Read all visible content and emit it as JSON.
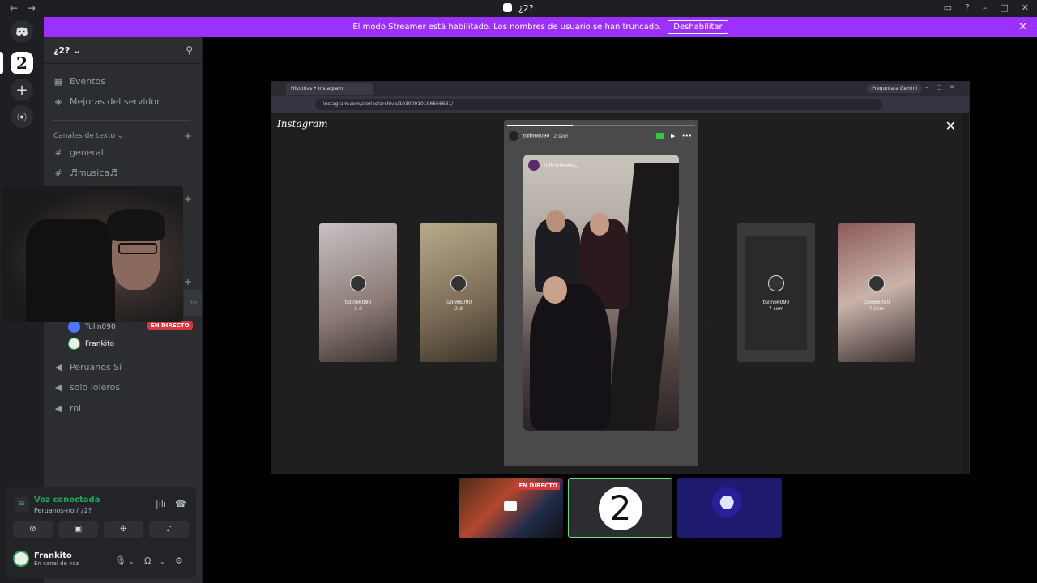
{
  "window": {
    "title": "¿2?",
    "nav_back": "←",
    "nav_fwd": "→",
    "controls": [
      "▭",
      "?",
      "–",
      "□",
      "✕"
    ]
  },
  "banner": {
    "text": "El modo Streamer está habilitado. Los nombres de usuario se han truncado.",
    "button": "Deshabilitar",
    "close": "✕"
  },
  "guilds": {
    "home_icon": "discord-icon",
    "server_label": "2",
    "add_icon": "+",
    "explore_icon": "⦿"
  },
  "server": {
    "name": "¿2? ⌄",
    "invite_icon": "⚲"
  },
  "sidebar": {
    "events": "Eventos",
    "boosts": "Mejoras del servidor",
    "text_category": "Canales de texto ⌄",
    "text_channels": [
      "general",
      "♬musica♬"
    ],
    "voice_count": "56",
    "voice_users": [
      {
        "name": "Tulin090",
        "badge": "EN DIRECTO"
      },
      {
        "name": "Frankito",
        "badge": ""
      }
    ],
    "voice_channels": [
      "Peruanos Sí",
      "solo loleros",
      "rol"
    ]
  },
  "voice_panel": {
    "status": "Voz conectada",
    "location": "Peruanos-no / ¿2?"
  },
  "user": {
    "name": "Frankito",
    "status": "En canal de voz"
  },
  "browser": {
    "tab_title": "Historias • Instagram",
    "url": "instagram.com/stories/archive/10300910196666631/",
    "gemini_label": "Pregunta a Gemini"
  },
  "instagram": {
    "logo": "Instagram",
    "close": "✕",
    "main_user": "tulin66090",
    "main_time": "2 sem",
    "inner_user": "milmvianaxx_",
    "side_stories": [
      {
        "user": "tulin66090",
        "time": "2 d"
      },
      {
        "user": "tulin66090",
        "time": "2 d"
      },
      {
        "user": "tulin66090",
        "time": "7 sem"
      },
      {
        "user": "tulin66090",
        "time": "7 sem"
      }
    ],
    "progress": 0.35
  },
  "tiles": {
    "live_badge": "EN DIRECTO",
    "center_label": "2"
  },
  "colors": {
    "banner": "#9b30ff",
    "live": "#da373c",
    "connected": "#23a55a",
    "sidebar": "#2b2d31"
  }
}
